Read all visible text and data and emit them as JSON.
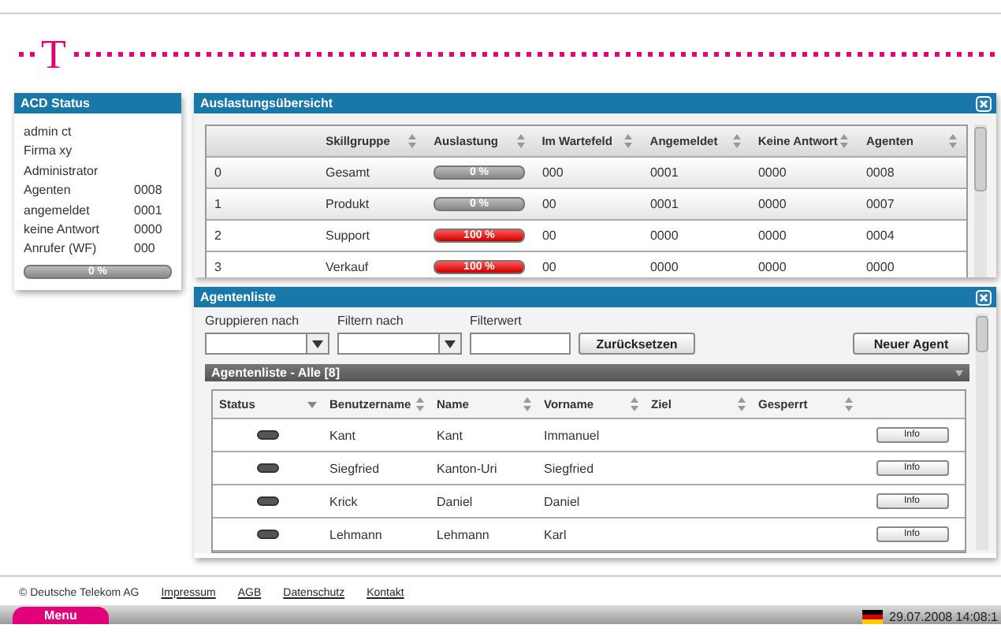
{
  "logo": "T",
  "acd_status": {
    "title": "ACD Status",
    "lines": [
      {
        "label": "admin ct"
      },
      {
        "label": "Firma xy"
      },
      {
        "label": "Administrator"
      },
      {
        "label": "Agenten",
        "value": "0008"
      },
      {
        "label": "angemeldet",
        "value": "0001"
      },
      {
        "label": "keine Antwort",
        "value": "0000"
      },
      {
        "label": "Anrufer (WF)",
        "value": "000"
      }
    ],
    "load": {
      "level": 0,
      "label": "0 %"
    }
  },
  "utilization": {
    "title": "Auslastungsübersicht",
    "columns": [
      {
        "kind": "plain"
      },
      {
        "label": "Skillgruppe",
        "kind": "sortable"
      },
      {
        "label": "Auslastung",
        "kind": "sortable"
      },
      {
        "label": "Im Wartefeld",
        "kind": "sortable"
      },
      {
        "label": "Angemeldet",
        "kind": "sortable"
      },
      {
        "label": "Keine Antwort",
        "kind": "sortable"
      },
      {
        "label": "Agenten",
        "kind": "sortable"
      }
    ],
    "rows": [
      {
        "index": "0",
        "skill": "Gesamt",
        "load": {
          "level": 0,
          "label": "0 %"
        },
        "waiting": "000",
        "logged_in": "0001",
        "no_answer": "0000",
        "agents": "0008"
      },
      {
        "index": "1",
        "skill": "Produkt",
        "load": {
          "level": 0,
          "label": "0 %"
        },
        "waiting": "00",
        "logged_in": "0001",
        "no_answer": "0000",
        "agents": "0007"
      },
      {
        "index": "2",
        "skill": "Support",
        "load": {
          "level": 1,
          "label": "100 %"
        },
        "waiting": "00",
        "logged_in": "0000",
        "no_answer": "0000",
        "agents": "0004"
      },
      {
        "index": "3",
        "skill": "Verkauf",
        "load": {
          "level": 1,
          "label": "100 %"
        },
        "waiting": "00",
        "logged_in": "0000",
        "no_answer": "0000",
        "agents": "0000"
      }
    ]
  },
  "agent_list": {
    "title": "Agentenliste",
    "filters": [
      {
        "label": "Gruppieren nach",
        "kind": "dropdown"
      },
      {
        "label": "Filtern nach",
        "kind": "dropdown"
      },
      {
        "label": "Filterwert",
        "kind": "text"
      }
    ],
    "reset_button": "Zurücksetzen",
    "new_button": "Neuer Agent",
    "group_bar": "Agentenliste - Alle [8]",
    "columns": [
      {
        "label": "Status",
        "kind": "sorted"
      },
      {
        "label": "Benutzername",
        "kind": "sortable"
      },
      {
        "label": "Name",
        "kind": "sortable"
      },
      {
        "label": "Vorname",
        "kind": "sortable"
      },
      {
        "label": "Ziel",
        "kind": "sortable"
      },
      {
        "label": "Gesperrt",
        "kind": "sortable"
      },
      {
        "kind": "plain"
      }
    ],
    "rows": [
      {
        "username": "Kant",
        "name": "Kant",
        "first_name": "Immanuel",
        "button": "Info"
      },
      {
        "username": "Siegfried",
        "name": "Kanton-Uri",
        "first_name": "Siegfried",
        "button": "Info"
      },
      {
        "username": "Krick",
        "name": "Daniel",
        "first_name": "Daniel",
        "button": "Info"
      },
      {
        "username": "Lehmann",
        "name": "Lehmann",
        "first_name": "Karl",
        "button": "Info"
      }
    ]
  },
  "footer": {
    "copyright": "© Deutsche Telekom AG",
    "links": [
      "Impressum",
      "AGB",
      "Datenschutz",
      "Kontakt"
    ]
  },
  "taskbar": {
    "menu": "Menu",
    "datetime": "29.07.2008 14:08:1"
  }
}
